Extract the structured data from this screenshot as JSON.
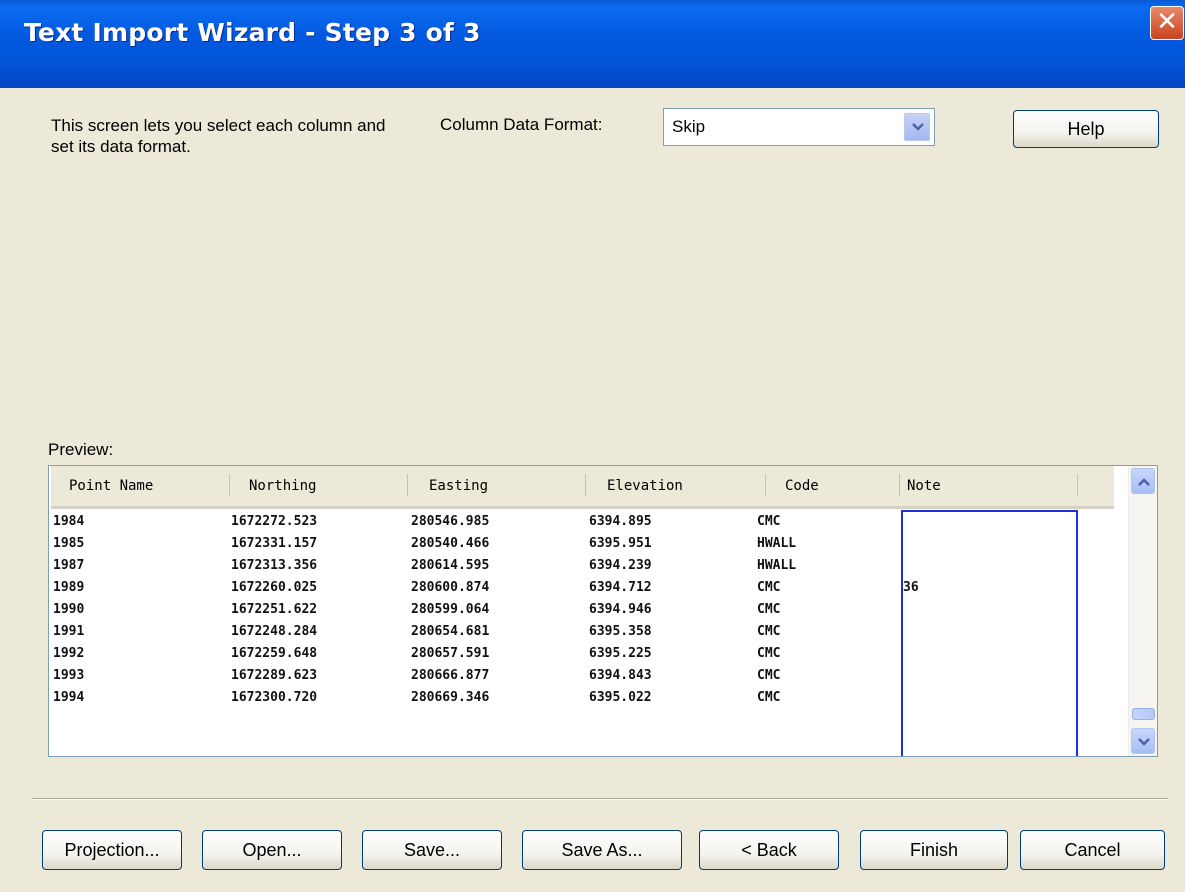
{
  "window": {
    "title": "Text Import Wizard - Step 3 of 3",
    "close_glyph": "✕"
  },
  "description": "This screen lets you select each column and set its data format.",
  "column_format": {
    "label": "Column Data Format:",
    "value": "Skip"
  },
  "help_label": "Help",
  "preview": {
    "label": "Preview:",
    "columns": [
      "Point Name",
      "Northing",
      "Easting",
      "Elevation",
      "Code",
      "Note"
    ],
    "rows": [
      [
        "1984",
        "1672272.523",
        "280546.985",
        "6394.895",
        "CMC",
        ""
      ],
      [
        "1985",
        "1672331.157",
        "280540.466",
        "6395.951",
        "HWALL",
        ""
      ],
      [
        "1987",
        "1672313.356",
        "280614.595",
        "6394.239",
        "HWALL",
        ""
      ],
      [
        "1989",
        "1672260.025",
        "280600.874",
        "6394.712",
        "CMC",
        "36"
      ],
      [
        "1990",
        "1672251.622",
        "280599.064",
        "6394.946",
        "CMC",
        ""
      ],
      [
        "1991",
        "1672248.284",
        "280654.681",
        "6395.358",
        "CMC",
        ""
      ],
      [
        "1992",
        "1672259.648",
        "280657.591",
        "6395.225",
        "CMC",
        ""
      ],
      [
        "1993",
        "1672289.623",
        "280666.877",
        "6394.843",
        "CMC",
        ""
      ],
      [
        "1994",
        "1672300.720",
        "280669.346",
        "6395.022",
        "CMC",
        ""
      ]
    ]
  },
  "buttons": {
    "projection": "Projection...",
    "open": "Open...",
    "save": "Save...",
    "save_as": "Save As...",
    "back": "< Back",
    "finish": "Finish",
    "cancel": "Cancel"
  }
}
